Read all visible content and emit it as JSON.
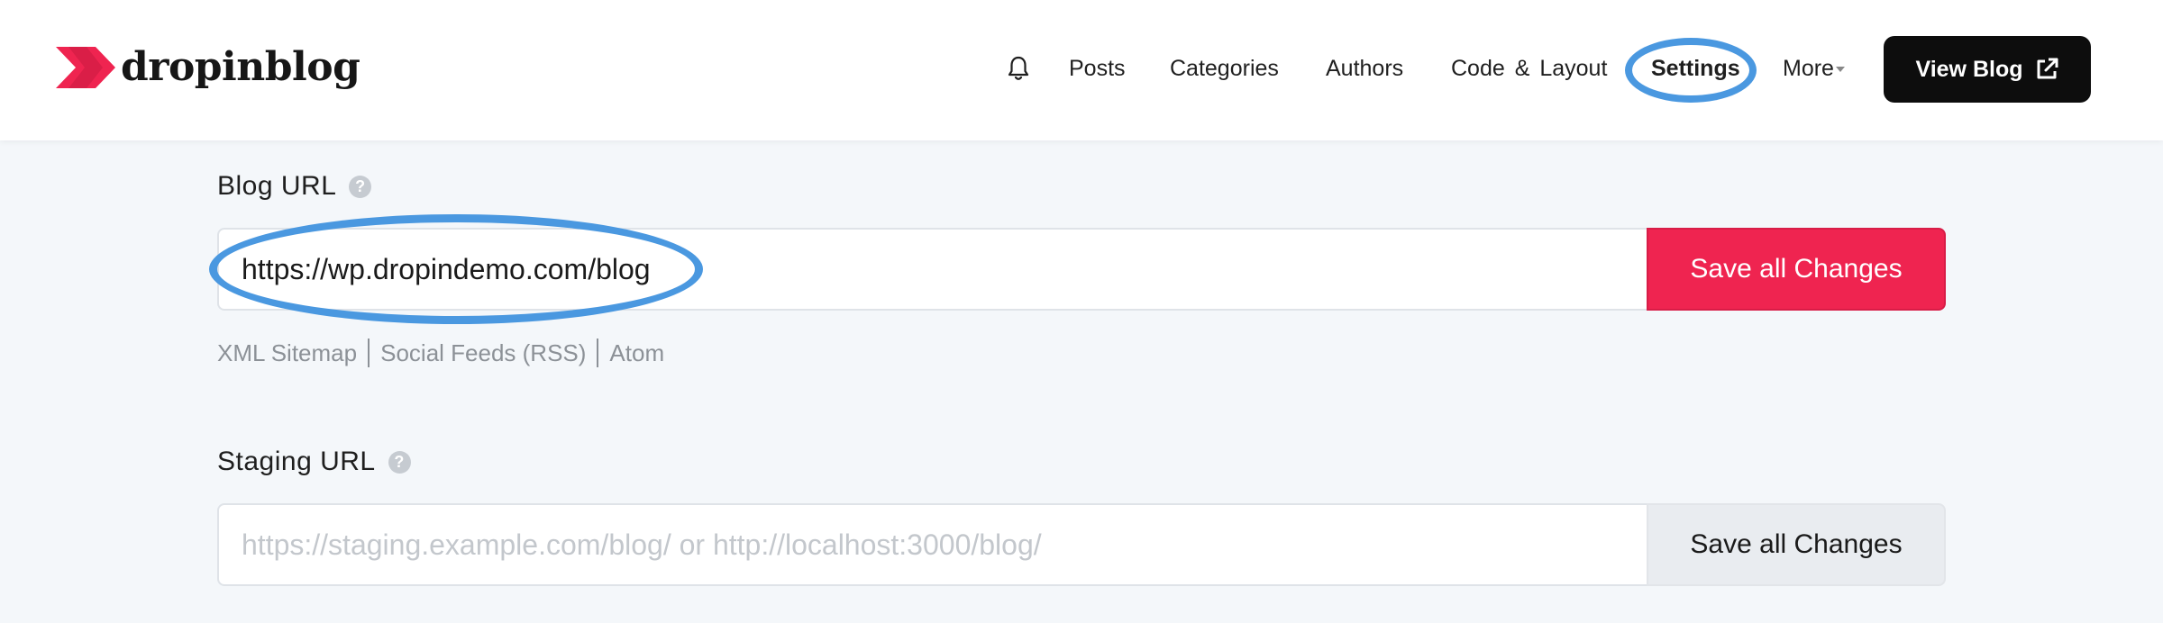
{
  "brand": {
    "name": "dropinblog",
    "accent": "#ef2450"
  },
  "nav": {
    "bell_icon": "bell-icon",
    "posts": "Posts",
    "categories": "Categories",
    "authors": "Authors",
    "code_layout": "Code & Layout",
    "settings": "Settings",
    "more": "More",
    "view_blog": "View Blog"
  },
  "blog_url": {
    "label": "Blog URL",
    "help_icon": "question-circle-icon",
    "value": "https://wp.dropindemo.com/blog",
    "save_label": "Save all Changes",
    "links": [
      "XML Sitemap",
      "Social Feeds (RSS)",
      "Atom"
    ]
  },
  "staging_url": {
    "label": "Staging URL",
    "help_icon": "question-circle-icon",
    "placeholder": "https://staging.example.com/blog/ or http://localhost:3000/blog/",
    "save_label": "Save all Changes"
  },
  "colors": {
    "highlight_ring": "#4a98e0",
    "primary_button": "#ef2450",
    "dark_button": "#0d0d0d"
  }
}
